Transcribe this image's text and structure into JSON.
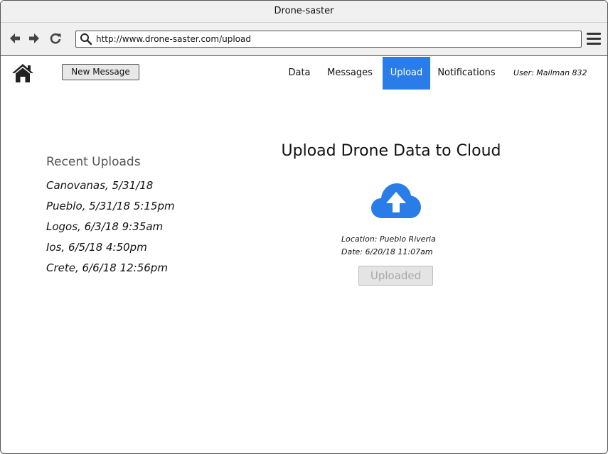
{
  "window": {
    "title": "Drone-saster"
  },
  "browser": {
    "url": "http://www.drone-saster.com/upload",
    "back_icon": "back-arrow-icon",
    "forward_icon": "forward-arrow-icon",
    "reload_icon": "reload-icon",
    "search_icon": "search-icon",
    "menu_icon": "hamburger-menu-icon"
  },
  "header": {
    "home_icon": "home-icon",
    "new_message_label": "New Message",
    "nav": [
      {
        "label": "Data",
        "active": false
      },
      {
        "label": "Messages",
        "active": false
      },
      {
        "label": "Upload",
        "active": true
      },
      {
        "label": "Notifications",
        "active": false
      }
    ],
    "user_label": "User: Mailman 832"
  },
  "recent": {
    "title": "Recent Uploads",
    "items": [
      "Canovanas, 5/31/18",
      "Pueblo, 5/31/18 5:15pm",
      "Logos, 6/3/18 9:35am",
      "Ios, 6/5/18 4:50pm",
      "Crete, 6/6/18 12:56pm"
    ]
  },
  "upload": {
    "title": "Upload Drone Data to Cloud",
    "icon": "cloud-upload-icon",
    "location": "Location: Pueblo Riveria",
    "date": "Date: 6/20/18 11:07am",
    "button_label": "Uploaded",
    "button_disabled": true
  },
  "colors": {
    "accent": "#2a7de8",
    "chrome": "#f0f0f0",
    "muted_text": "#555555"
  }
}
